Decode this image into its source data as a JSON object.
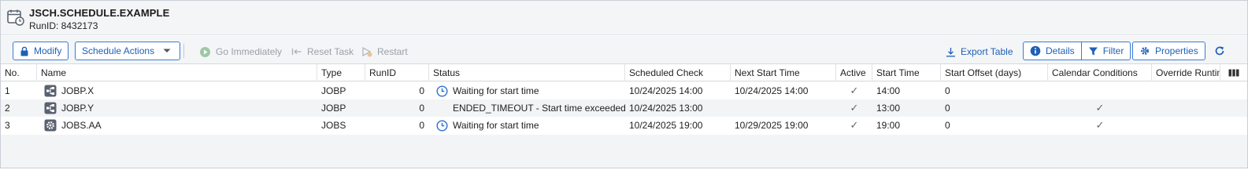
{
  "header": {
    "title": "JSCH.SCHEDULE.EXAMPLE",
    "runid": "RunID: 8432173"
  },
  "toolbar": {
    "modify": "Modify",
    "schedule_actions": "Schedule Actions",
    "go_immediately": "Go Immediately",
    "reset_task": "Reset Task",
    "restart": "Restart",
    "export_table": "Export Table",
    "details": "Details",
    "filter": "Filter",
    "properties": "Properties"
  },
  "colors": {
    "accent": "#1f5fb8",
    "clock": "#2f6fd0",
    "disabled": "#9aa0a8"
  },
  "table": {
    "columns": [
      "No.",
      "Name",
      "Type",
      "RunID",
      "Status",
      "Scheduled Check",
      "Next Start Time",
      "Active",
      "Start Time",
      "Start Offset (days)",
      "Calendar Conditions",
      "Override Runtim"
    ],
    "rows": [
      {
        "no": "1",
        "name": "JOBP.X",
        "icon": "workflow-icon",
        "type": "JOBP",
        "runid": "0",
        "status_icon": "clock-icon",
        "status": "Waiting for start time",
        "scheduled_check": "10/24/2025 14:00",
        "next_start": "10/24/2025 14:00",
        "active": "✓",
        "start_time": "14:00",
        "offset": "0",
        "calendar": ""
      },
      {
        "no": "2",
        "name": "JOBP.Y",
        "icon": "workflow-icon",
        "type": "JOBP",
        "runid": "0",
        "status_icon": "",
        "status": "ENDED_TIMEOUT - Start time exceeded.",
        "scheduled_check": "10/24/2025 13:00",
        "next_start": "",
        "active": "✓",
        "start_time": "13:00",
        "offset": "0",
        "calendar": "✓"
      },
      {
        "no": "3",
        "name": "JOBS.AA",
        "icon": "job-gear-icon",
        "type": "JOBS",
        "runid": "0",
        "status_icon": "clock-icon",
        "status": "Waiting for start time",
        "scheduled_check": "10/24/2025 19:00",
        "next_start": "10/29/2025 19:00",
        "active": "✓",
        "start_time": "19:00",
        "offset": "0",
        "calendar": "✓"
      }
    ]
  }
}
